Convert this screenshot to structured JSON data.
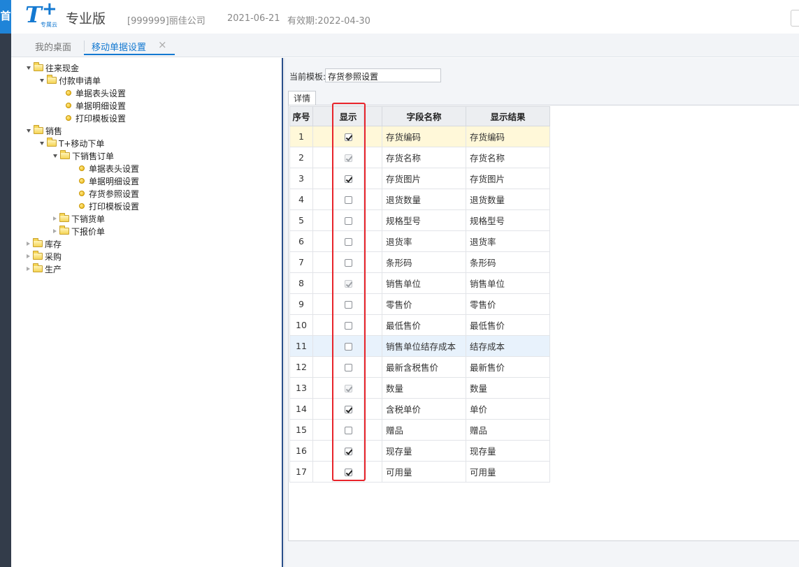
{
  "header": {
    "logo_letter": "T",
    "logo_plus": "+",
    "logo_sub": "专属云",
    "edition": "专业版",
    "company": "[999999]丽佳公司",
    "date": "2021-06-21",
    "validity": "有效期:2022-04-30",
    "left_strip_glyph": "首"
  },
  "tabs": [
    {
      "label": "我的桌面"
    },
    {
      "label": "移动单据设置",
      "active": true,
      "close_icon": "×"
    }
  ],
  "tree": [
    {
      "label": "往来现金",
      "level": 0,
      "kind": "folder",
      "state": "expanded"
    },
    {
      "label": "付款申请单",
      "level": 1,
      "kind": "folder",
      "state": "expanded"
    },
    {
      "label": "单据表头设置",
      "level": 2,
      "kind": "leaf"
    },
    {
      "label": "单据明细设置",
      "level": 2,
      "kind": "leaf"
    },
    {
      "label": "打印模板设置",
      "level": 2,
      "kind": "leaf"
    },
    {
      "label": "销售",
      "level": 0,
      "kind": "folder",
      "state": "expanded"
    },
    {
      "label": "T+移动下单",
      "level": 1,
      "kind": "folder",
      "state": "expanded"
    },
    {
      "label": "下销售订单",
      "level": 2,
      "kind": "folder",
      "state": "expanded"
    },
    {
      "label": "单据表头设置",
      "level": 3,
      "kind": "leaf"
    },
    {
      "label": "单据明细设置",
      "level": 3,
      "kind": "leaf"
    },
    {
      "label": "存货参照设置",
      "level": 3,
      "kind": "leaf"
    },
    {
      "label": "打印模板设置",
      "level": 3,
      "kind": "leaf"
    },
    {
      "label": "下销货单",
      "level": 2,
      "kind": "folder",
      "state": "collapsed"
    },
    {
      "label": "下报价单",
      "level": 2,
      "kind": "folder",
      "state": "collapsed"
    },
    {
      "label": "库存",
      "level": 0,
      "kind": "folder",
      "state": "collapsed"
    },
    {
      "label": "采购",
      "level": 0,
      "kind": "folder",
      "state": "collapsed"
    },
    {
      "label": "生产",
      "level": 0,
      "kind": "folder",
      "state": "collapsed"
    }
  ],
  "panel": {
    "template_label": "当前模板:",
    "template_value": "存货参照设置",
    "detail_tab": "详情"
  },
  "grid": {
    "columns": [
      "序号",
      "显示",
      "字段名称",
      "显示结果"
    ],
    "rows": [
      {
        "no": "1",
        "checked": true,
        "disabled": false,
        "field": "存货编码",
        "result": "存货编码",
        "state": "selected"
      },
      {
        "no": "2",
        "checked": true,
        "disabled": true,
        "field": "存货名称",
        "result": "存货名称"
      },
      {
        "no": "3",
        "checked": true,
        "disabled": false,
        "field": "存货图片",
        "result": "存货图片"
      },
      {
        "no": "4",
        "checked": false,
        "disabled": false,
        "field": "退货数量",
        "result": "退货数量"
      },
      {
        "no": "5",
        "checked": false,
        "disabled": false,
        "field": "规格型号",
        "result": "规格型号"
      },
      {
        "no": "6",
        "checked": false,
        "disabled": false,
        "field": "退货率",
        "result": "退货率"
      },
      {
        "no": "7",
        "checked": false,
        "disabled": false,
        "field": "条形码",
        "result": "条形码"
      },
      {
        "no": "8",
        "checked": true,
        "disabled": true,
        "field": "销售单位",
        "result": "销售单位"
      },
      {
        "no": "9",
        "checked": false,
        "disabled": false,
        "field": "零售价",
        "result": "零售价"
      },
      {
        "no": "10",
        "checked": false,
        "disabled": false,
        "field": "最低售价",
        "result": "最低售价"
      },
      {
        "no": "11",
        "checked": false,
        "disabled": false,
        "field": "销售单位结存成本",
        "result": "结存成本",
        "state": "hover"
      },
      {
        "no": "12",
        "checked": false,
        "disabled": false,
        "field": "最新含税售价",
        "result": "最新售价"
      },
      {
        "no": "13",
        "checked": true,
        "disabled": true,
        "field": "数量",
        "result": "数量"
      },
      {
        "no": "14",
        "checked": true,
        "disabled": false,
        "field": "含税单价",
        "result": "单价"
      },
      {
        "no": "15",
        "checked": false,
        "disabled": false,
        "field": "赠品",
        "result": "赠品"
      },
      {
        "no": "16",
        "checked": true,
        "disabled": false,
        "field": "现存量",
        "result": "现存量"
      },
      {
        "no": "17",
        "checked": true,
        "disabled": false,
        "field": "可用量",
        "result": "可用量"
      }
    ]
  },
  "colors": {
    "accent": "#1479d1",
    "highlight_border": "#e8232a",
    "selected_row": "#fff8d9",
    "hover_row": "#e8f2fc"
  }
}
